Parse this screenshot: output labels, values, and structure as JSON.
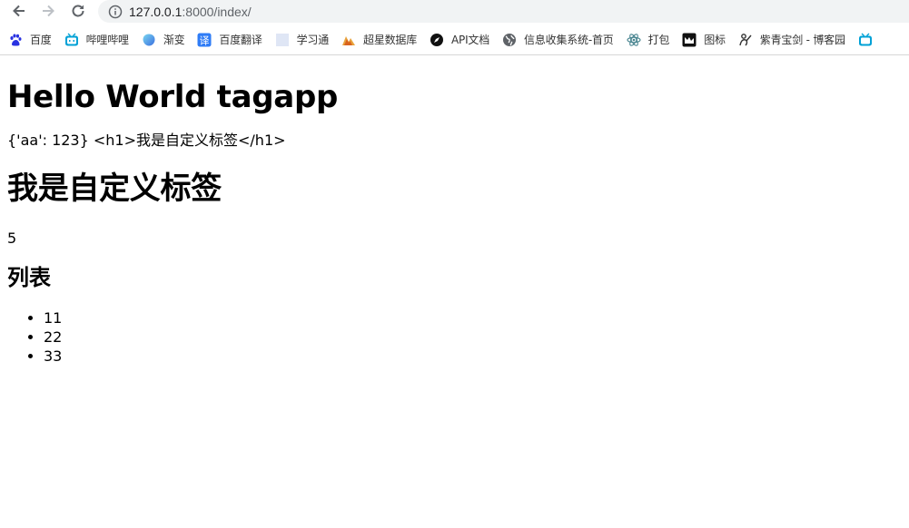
{
  "browser": {
    "url_host": "127.0.0.1",
    "url_rest": ":8000/index/",
    "bookmarks": [
      {
        "label": "百度",
        "icon": "baidu-paw-icon",
        "color": "#2932e1"
      },
      {
        "label": "哔哩哔哩",
        "icon": "bilibili-tv-icon",
        "color": "#00a1d6"
      },
      {
        "label": "渐变",
        "icon": "gradient-blob-icon",
        "color": "#4a90e2"
      },
      {
        "label": "百度翻译",
        "icon": "translate-icon",
        "color": "#2f7cf6"
      },
      {
        "label": "学习通",
        "icon": "blank-page-icon",
        "color": "#dfe6f5"
      },
      {
        "label": "超星数据库",
        "icon": "chaoxing-icon",
        "color": "#d9631e"
      },
      {
        "label": "API文档",
        "icon": "compass-icon",
        "color": "#111111"
      },
      {
        "label": "信息收集系统-首页",
        "icon": "globe-icon",
        "color": "#5f6368"
      },
      {
        "label": "打包",
        "icon": "electron-icon",
        "color": "#47848f"
      },
      {
        "label": "图标",
        "icon": "image-frame-icon",
        "color": "#111111"
      },
      {
        "label": "紫青宝剑 - 博客园",
        "icon": "blog-person-icon",
        "color": "#333333"
      }
    ]
  },
  "content": {
    "title": "Hello World tagapp",
    "raw_line": "{'aa': 123} <h1>我是自定义标签</h1>",
    "rendered_heading": "我是自定义标签",
    "number": "5",
    "list_heading": "列表",
    "list_items": [
      "11",
      "22",
      "33"
    ]
  }
}
